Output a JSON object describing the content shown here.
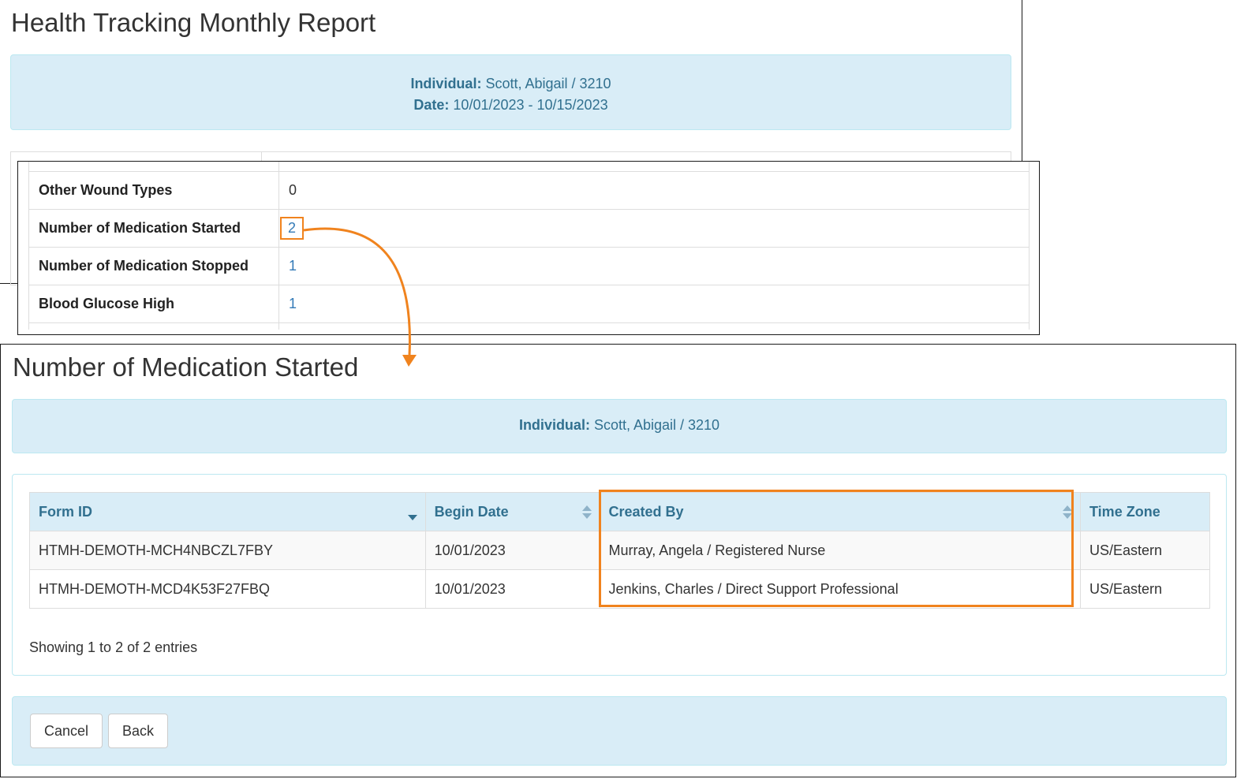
{
  "report": {
    "title": "Health Tracking Monthly Report",
    "individual_label": "Individual:",
    "individual_value": "Scott, Abigail / 3210",
    "date_label": "Date:",
    "date_value": "10/01/2023 - 10/15/2023"
  },
  "detail_rows": [
    {
      "label": "Other Wound Types",
      "value": "0"
    },
    {
      "label": "Number of Medication Started",
      "value": "2"
    },
    {
      "label": "Number of Medication Stopped",
      "value": "1"
    },
    {
      "label": "Blood Glucose High",
      "value": "1"
    }
  ],
  "medication": {
    "title": "Number of Medication Started",
    "individual_label": "Individual:",
    "individual_value": "Scott, Abigail / 3210",
    "columns": [
      "Form ID",
      "Begin Date",
      "Created By",
      "Time Zone"
    ],
    "rows": [
      [
        "HTMH-DEMOTH-MCH4NBCZL7FBY",
        "10/01/2023",
        "Murray, Angela / Registered Nurse",
        "US/Eastern"
      ],
      [
        "HTMH-DEMOTH-MCD4K53F27FBQ",
        "10/01/2023",
        "Jenkins, Charles / Direct Support Professional",
        "US/Eastern"
      ]
    ],
    "info": "Showing 1 to 2 of 2 entries",
    "cancel_label": "Cancel",
    "back_label": "Back"
  },
  "colors": {
    "highlight": "#f0831e",
    "info_bg": "#d9edf7",
    "info_text": "#31708f",
    "link": "#337ab7"
  }
}
